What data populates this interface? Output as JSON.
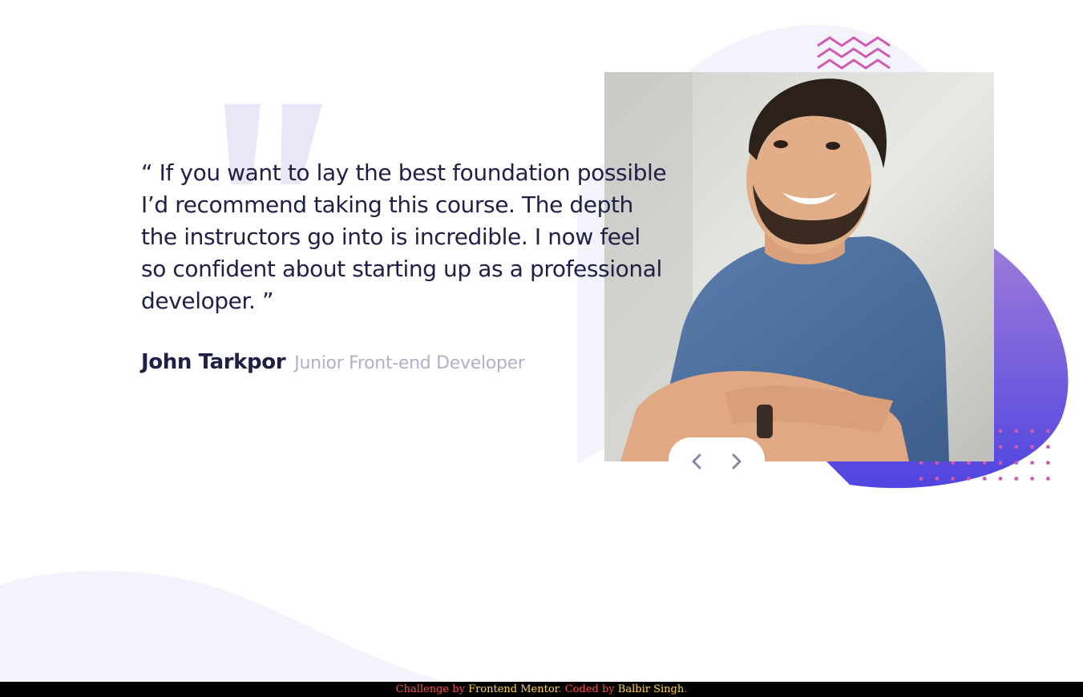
{
  "testimonial": {
    "quote": "“ If you want to lay the best foundation possible I’d recommend taking this course. The depth the instructors go into is incredible. I now feel so confident about starting up as a professional developer. ”",
    "author_name": "John Tarkpor",
    "author_role": "Junior Front-end Developer"
  },
  "photo": {
    "alt": "John Tarkpor"
  },
  "navigation": {
    "prev_icon": "chevron-left-icon",
    "next_icon": "chevron-right-icon"
  },
  "footer": {
    "text_challenge": "Challenge by ",
    "link_frontend_mentor": "Frontend Mentor",
    "text_coded": ". Coded by ",
    "link_author": "Balbir Singh",
    "text_end": "."
  },
  "colors": {
    "text_dark": "#202046",
    "text_muted": "#b0b0cb",
    "accent_purple": "#6359e8",
    "accent_pink": "#d05ab0",
    "light_lavender": "#f3f3fb",
    "footer_red": "#ff4d4d",
    "footer_yellow": "#ffd452"
  }
}
